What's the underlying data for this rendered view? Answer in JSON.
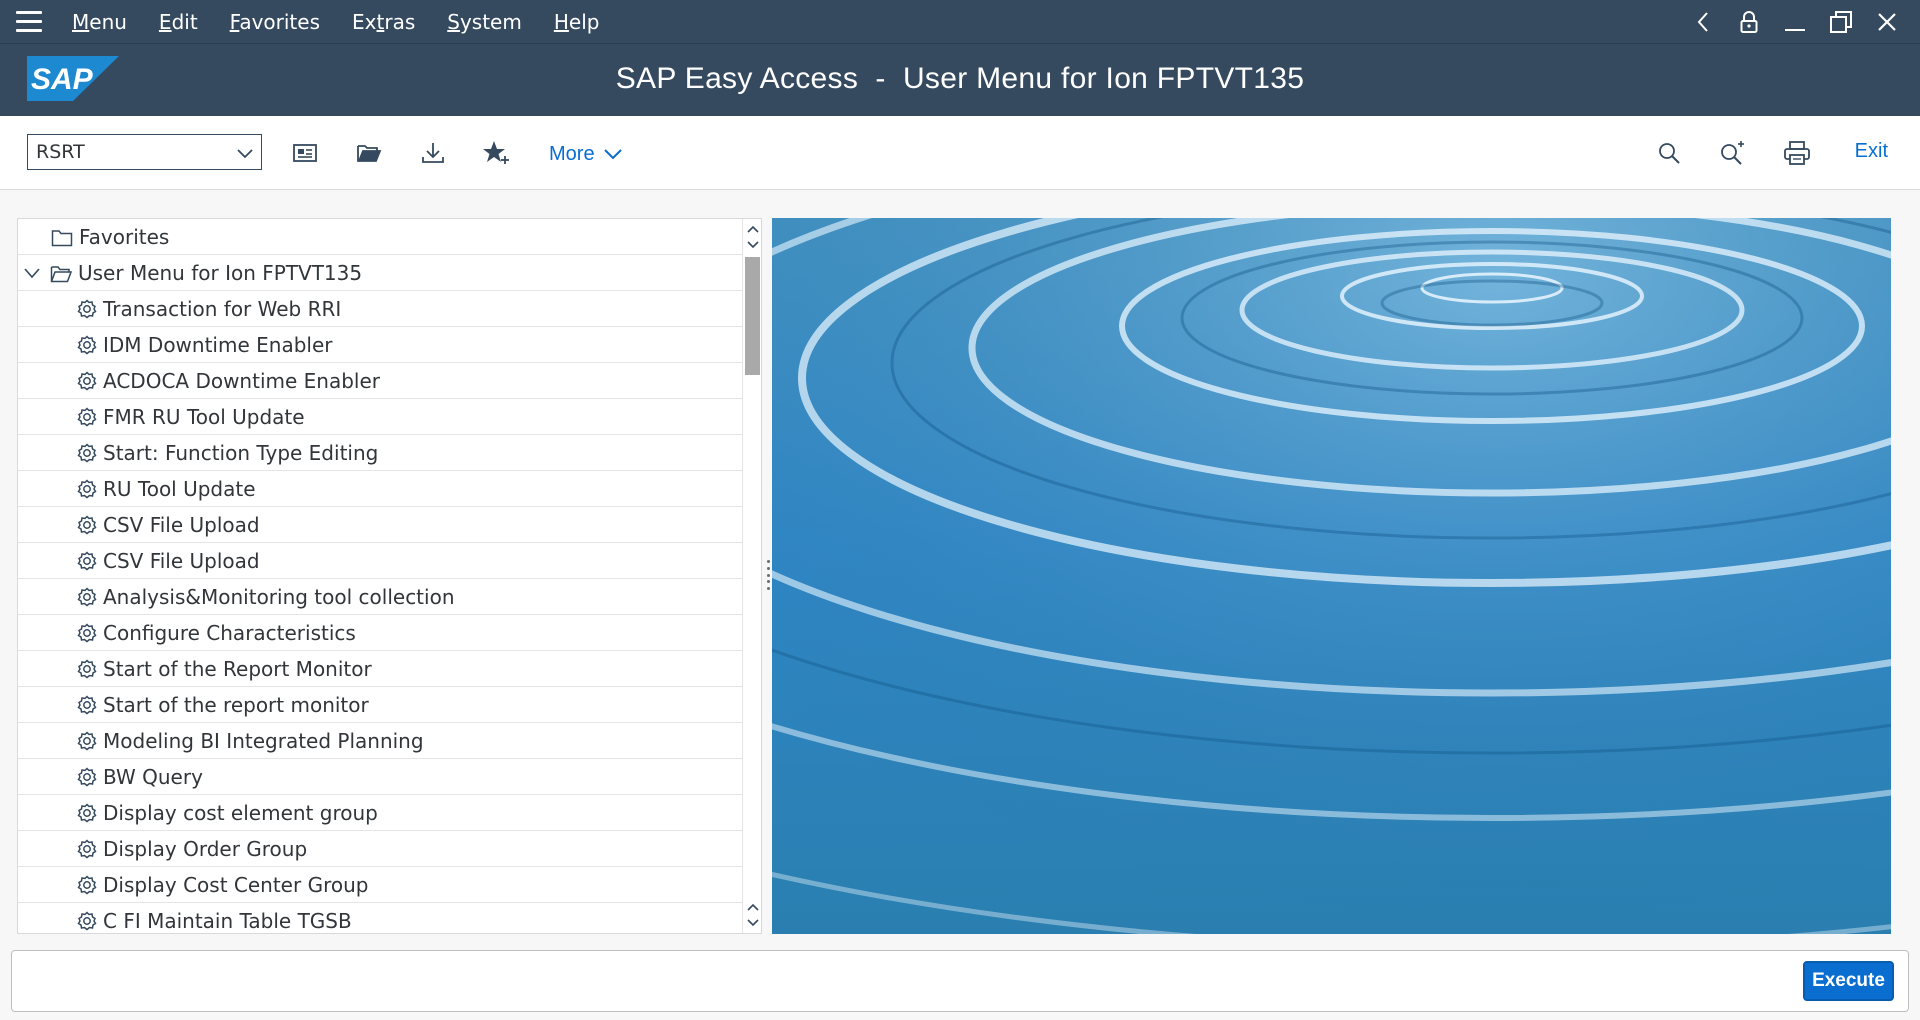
{
  "menubar": {
    "items": [
      {
        "pre": "",
        "u": "M",
        "post": "enu"
      },
      {
        "pre": "",
        "u": "E",
        "post": "dit"
      },
      {
        "pre": "",
        "u": "F",
        "post": "avorites"
      },
      {
        "pre": "Ex",
        "u": "t",
        "post": "ras"
      },
      {
        "pre": "",
        "u": "S",
        "post": "ystem"
      },
      {
        "pre": "",
        "u": "H",
        "post": "elp"
      }
    ]
  },
  "titlebar": {
    "logo_text": "SAP",
    "title": "SAP Easy Access  -  User Menu for Ion FPTVT135"
  },
  "toolbar": {
    "command_value": "RSRT",
    "more_label": "More",
    "exit_label": "Exit"
  },
  "tree": {
    "favorites_label": "Favorites",
    "user_menu_label": "User Menu for Ion FPTVT135",
    "items": [
      "Transaction for Web RRI",
      "IDM Downtime Enabler",
      "ACDOCA Downtime Enabler",
      "FMR RU Tool Update",
      "Start: Function Type Editing",
      "RU Tool Update",
      "CSV File Upload",
      "CSV File Upload",
      "Analysis&Monitoring tool collection",
      "Configure Characteristics",
      "Start of the Report Monitor",
      "Start of the report monitor",
      "Modeling BI Integrated Planning",
      "BW Query",
      "Display cost element group",
      "Display Order Group",
      "Display Cost Center Group",
      "C FI Maintain Table TGSB"
    ]
  },
  "footer": {
    "execute_label": "Execute"
  },
  "colors": {
    "shell": "#354a5f",
    "accent": "#0a6ed1",
    "panel_bg": "#ffffff",
    "page_bg": "#f7f7f7"
  }
}
